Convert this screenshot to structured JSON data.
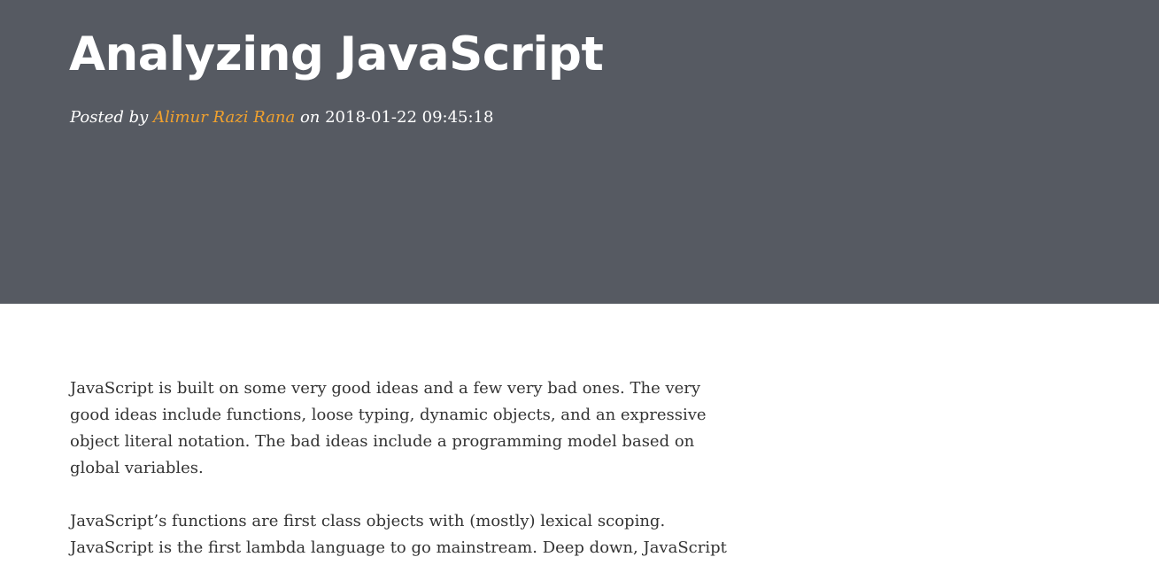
{
  "header": {
    "title": "Analyzing JavaScript",
    "posted_by_label": "Posted by",
    "author": "Alimur Razi Rana",
    "on_label": "on",
    "datetime": "2018-01-22 09:45:18"
  },
  "colors": {
    "hero_background": "#565a62",
    "author_link": "#f0a12e",
    "body_text": "#333333"
  },
  "article": {
    "paragraphs": [
      "JavaScript is built on some very good ideas and a few very bad ones. The very good ideas include functions, loose typing, dynamic objects, and an expressive object literal notation. The bad ideas include a programming model based on global variables.",
      "JavaScript’s functions are first class objects with (mostly) lexical scoping. JavaScript is the first lambda language to go mainstream. Deep down, JavaScript"
    ]
  }
}
